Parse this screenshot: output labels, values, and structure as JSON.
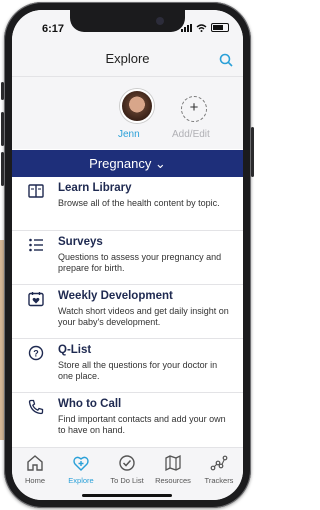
{
  "status": {
    "time": "6:17"
  },
  "header": {
    "title": "Explore"
  },
  "profiles": {
    "user_name": "Jenn",
    "add_label": "Add/Edit"
  },
  "banner": {
    "label": "Pregnancy ⌄"
  },
  "items": [
    {
      "title": "Learn Library",
      "desc": "Browse all of the health content by topic.",
      "icon": "book-icon"
    },
    {
      "title": "Surveys",
      "desc": "Questions to assess your pregnancy and prepare for birth.",
      "icon": "checklist-icon"
    },
    {
      "title": "Weekly Development",
      "desc": "Watch short videos and get daily insight on your baby's development.",
      "icon": "calendar-heart-icon"
    },
    {
      "title": "Q-List",
      "desc": "Store all the questions for your doctor in one place.",
      "icon": "question-icon"
    },
    {
      "title": "Who to Call",
      "desc": "Find important contacts and add your own to have on hand.",
      "icon": "phone-icon"
    }
  ],
  "tabs": [
    {
      "label": "Home",
      "icon": "home-icon"
    },
    {
      "label": "Explore",
      "icon": "explore-icon"
    },
    {
      "label": "To Do List",
      "icon": "check-circle-icon"
    },
    {
      "label": "Resources",
      "icon": "map-icon"
    },
    {
      "label": "Trackers",
      "icon": "trackers-icon"
    }
  ],
  "colors": {
    "brand_navy": "#1e2f7a",
    "accent_blue": "#2aa0d8",
    "title_text": "#1e2950"
  }
}
